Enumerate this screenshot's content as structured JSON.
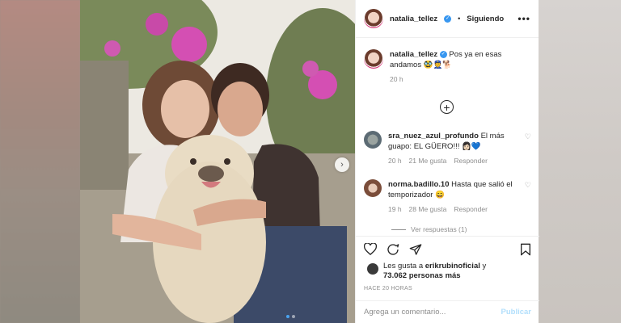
{
  "post": {
    "username": "natalia_tellez",
    "follow_separator": "•",
    "follow_status": "Siguiendo",
    "more_label": "•••",
    "verified_glyph": "✓"
  },
  "caption": {
    "username": "natalia_tellez",
    "text": "Pos ya en esas andamos 🥸👮🐕",
    "time": "20 h"
  },
  "comments": [
    {
      "username": "sra_nuez_azul_profundo",
      "text": "El más guapo: EL GÜERO!!! 👩🏻💙",
      "time": "20 h",
      "likes": "21 Me gusta",
      "reply": "Responder"
    },
    {
      "username": "norma.badillo.10",
      "text": "Hasta que salió el temporizador 😄",
      "time": "19 h",
      "likes": "28 Me gusta",
      "reply": "Responder"
    }
  ],
  "view_replies": "Ver respuestas (1)",
  "likes": {
    "prefix": "Les gusta a",
    "user": "erikrubinoficial",
    "middle": "y",
    "count": "73.062 personas más"
  },
  "timestamp": "HACE 20 HORAS",
  "add_comment": {
    "placeholder": "Agrega un comentario...",
    "publish": "Publicar"
  },
  "icons": [
    "more-icon",
    "plus-circle-icon",
    "heart-icon",
    "comment-icon",
    "share-icon",
    "bookmark-icon",
    "chevron-right-icon"
  ],
  "colors": {
    "verified": "#3897f0",
    "publish_disabled": "#b2dffc",
    "secondary_text": "#8e8e8e"
  }
}
